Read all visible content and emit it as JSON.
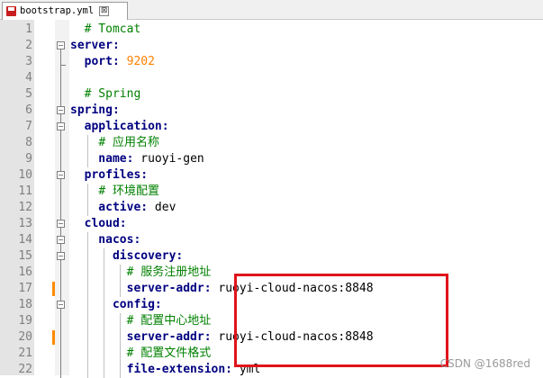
{
  "tab": {
    "filename": "bootstrap.yml",
    "close_glyph": "⊠"
  },
  "lines": [
    {
      "num": "1",
      "segments": [
        {
          "t": "  ",
          "c": "val"
        },
        {
          "t": "# Tomcat",
          "c": "cmt"
        }
      ]
    },
    {
      "num": "2",
      "segments": [
        {
          "t": "server:",
          "c": "key"
        }
      ]
    },
    {
      "num": "3",
      "segments": [
        {
          "t": "  port: ",
          "c": "key"
        },
        {
          "t": "9202",
          "c": "num"
        }
      ]
    },
    {
      "num": "4",
      "segments": []
    },
    {
      "num": "5",
      "segments": [
        {
          "t": "  ",
          "c": "val"
        },
        {
          "t": "# Spring",
          "c": "cmt"
        }
      ]
    },
    {
      "num": "6",
      "segments": [
        {
          "t": "spring:",
          "c": "key"
        }
      ]
    },
    {
      "num": "7",
      "segments": [
        {
          "t": "  application:",
          "c": "key"
        }
      ]
    },
    {
      "num": "8",
      "segments": [
        {
          "t": "    ",
          "c": "val"
        },
        {
          "t": "# 应用名称",
          "c": "cmt"
        }
      ]
    },
    {
      "num": "9",
      "segments": [
        {
          "t": "    name: ",
          "c": "key"
        },
        {
          "t": "ruoyi-gen",
          "c": "val"
        }
      ]
    },
    {
      "num": "10",
      "segments": [
        {
          "t": "  profiles:",
          "c": "key"
        }
      ]
    },
    {
      "num": "11",
      "segments": [
        {
          "t": "    ",
          "c": "val"
        },
        {
          "t": "# 环境配置",
          "c": "cmt"
        }
      ]
    },
    {
      "num": "12",
      "segments": [
        {
          "t": "    active: ",
          "c": "key"
        },
        {
          "t": "dev",
          "c": "val"
        }
      ]
    },
    {
      "num": "13",
      "segments": [
        {
          "t": "  cloud:",
          "c": "key"
        }
      ]
    },
    {
      "num": "14",
      "segments": [
        {
          "t": "    nacos:",
          "c": "key"
        }
      ]
    },
    {
      "num": "15",
      "segments": [
        {
          "t": "      discovery:",
          "c": "key"
        }
      ]
    },
    {
      "num": "16",
      "segments": [
        {
          "t": "        ",
          "c": "val"
        },
        {
          "t": "# 服务注册地址",
          "c": "cmt"
        }
      ]
    },
    {
      "num": "17",
      "segments": [
        {
          "t": "        server-addr: ",
          "c": "key"
        },
        {
          "t": "ruoyi-cloud-nacos:8848",
          "c": "val"
        }
      ]
    },
    {
      "num": "18",
      "segments": [
        {
          "t": "      config:",
          "c": "key"
        }
      ]
    },
    {
      "num": "19",
      "segments": [
        {
          "t": "        ",
          "c": "val"
        },
        {
          "t": "# 配置中心地址",
          "c": "cmt"
        }
      ]
    },
    {
      "num": "20",
      "segments": [
        {
          "t": "        server-addr: ",
          "c": "key"
        },
        {
          "t": "ruoyi-cloud-nacos:8848",
          "c": "val"
        }
      ]
    },
    {
      "num": "21",
      "segments": [
        {
          "t": "        ",
          "c": "val"
        },
        {
          "t": "# 配置文件格式",
          "c": "cmt"
        }
      ]
    },
    {
      "num": "22",
      "segments": [
        {
          "t": "        file-extension: ",
          "c": "key"
        },
        {
          "t": "yml",
          "c": "val"
        }
      ]
    }
  ],
  "fold_lines": [
    2,
    6,
    7,
    10,
    13,
    14,
    15,
    18
  ],
  "changed_lines": [
    17,
    20
  ],
  "watermark": "CSDN @1688red",
  "colors": {
    "highlight_box": "#e0141a",
    "change_marker": "#ff8a00"
  }
}
